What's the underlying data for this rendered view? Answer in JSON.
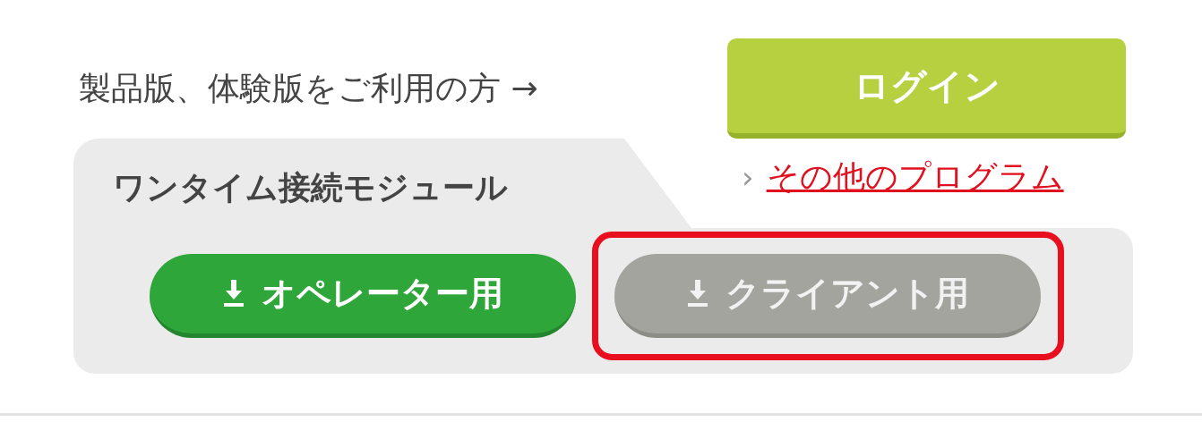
{
  "login_row": {
    "text": "製品版、体験版をご利用の方 →",
    "button": "ログイン"
  },
  "panel": {
    "tab": "ワンタイム接続モジュール",
    "link_marker": "›",
    "link": "その他のプログラム",
    "buttons": [
      {
        "label": "オペレーター用",
        "kind": "primary",
        "highlighted": false
      },
      {
        "label": "クライアント用",
        "kind": "muted",
        "highlighted": true
      }
    ]
  }
}
